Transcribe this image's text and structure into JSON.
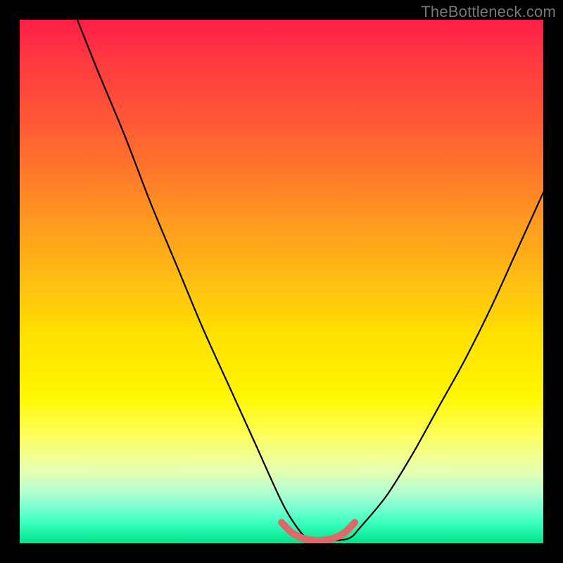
{
  "watermark": "TheBottleneck.com",
  "chart_data": {
    "type": "line",
    "title": "",
    "xlabel": "",
    "ylabel": "",
    "xlim": [
      0,
      100
    ],
    "ylim": [
      0,
      100
    ],
    "grid": false,
    "legend": false,
    "series": [
      {
        "name": "curve",
        "color": "#000000",
        "x": [
          11,
          15,
          20,
          25,
          30,
          35,
          40,
          45,
          50,
          53,
          55,
          58,
          60,
          63,
          65,
          70,
          75,
          80,
          85,
          90,
          95,
          100
        ],
        "values": [
          100,
          90,
          78,
          65,
          53,
          41,
          30,
          19,
          8,
          3,
          1,
          0.5,
          0.5,
          1,
          3,
          9,
          17,
          26,
          35,
          45,
          56,
          67
        ]
      },
      {
        "name": "valley-highlight",
        "color": "#e06868",
        "x": [
          50,
          52,
          54,
          56,
          58,
          60,
          62,
          64
        ],
        "values": [
          4,
          2,
          1,
          0.6,
          0.6,
          1,
          2,
          4
        ]
      }
    ],
    "gradient_stops": [
      {
        "pos": 0,
        "color": "#ff1d47"
      },
      {
        "pos": 8,
        "color": "#ff3a3f"
      },
      {
        "pos": 20,
        "color": "#ff5a35"
      },
      {
        "pos": 34,
        "color": "#ff8a25"
      },
      {
        "pos": 48,
        "color": "#ffb815"
      },
      {
        "pos": 60,
        "color": "#ffe000"
      },
      {
        "pos": 72,
        "color": "#fff700"
      },
      {
        "pos": 80,
        "color": "#fcff66"
      },
      {
        "pos": 86,
        "color": "#e6ffb0"
      },
      {
        "pos": 90,
        "color": "#b8ffcf"
      },
      {
        "pos": 93,
        "color": "#7dffd0"
      },
      {
        "pos": 96,
        "color": "#3cffc0"
      },
      {
        "pos": 100,
        "color": "#00e58a"
      }
    ]
  }
}
